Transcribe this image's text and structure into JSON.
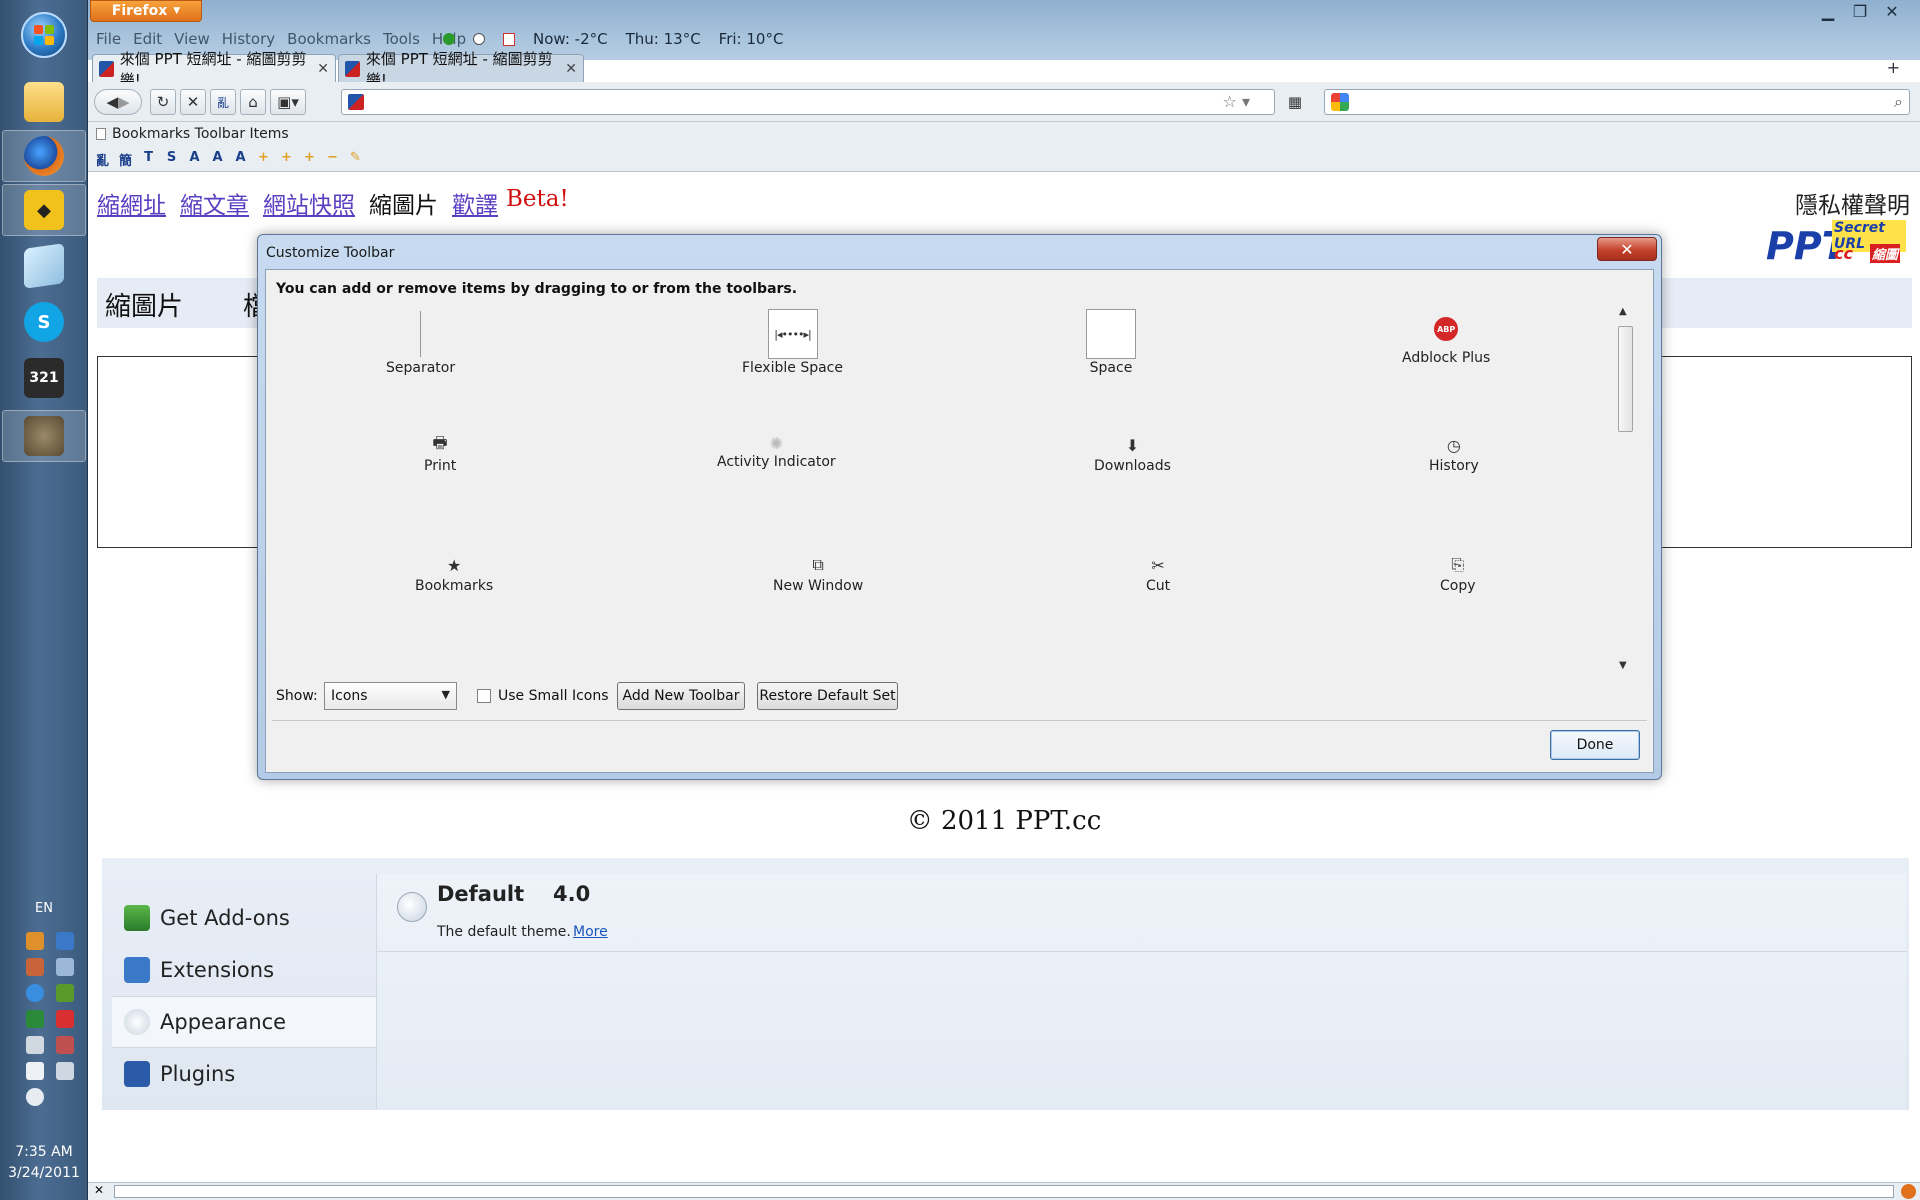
{
  "taskbar": {
    "language": "EN",
    "time": "7:35 AM",
    "date": "3/24/2011",
    "apps": [
      "explorer-icon",
      "firefox-icon",
      "media-icon",
      "notes-icon",
      "skype-icon",
      "media-player-icon",
      "gimp-icon"
    ]
  },
  "firefox": {
    "menu_button": "Firefox",
    "menus": [
      "File",
      "Edit",
      "View",
      "History",
      "Bookmarks",
      "Tools",
      "Help"
    ],
    "weather": {
      "now": "Now: -2°C",
      "thu": "Thu: 13°C",
      "fri": "Fri: 10°C"
    },
    "tabs": [
      {
        "title": "來個 PPT 短網址 - 縮圖剪剪樂!"
      },
      {
        "title": "來個 PPT 短網址 - 縮圖剪剪樂!"
      }
    ],
    "bookmarks_label": "Bookmarks Toolbar Items",
    "bm_icons": [
      "亂",
      "簡",
      "T",
      "S",
      "A",
      "A",
      "A",
      "+",
      "+",
      "+",
      "−",
      "✎"
    ]
  },
  "page": {
    "nav": {
      "short_url": "縮網址",
      "short_article": "縮文章",
      "snapshot": "網站快照",
      "thumbnail": "縮圖片",
      "translate": "歡譯",
      "beta": "Beta!"
    },
    "privacy": "隱私權聲明",
    "logo": {
      "main": "PPT",
      "sub": "Secret URL",
      "cc": "cc",
      "cn": "縮圖"
    },
    "section_title": "縮圖片",
    "section_title2": "檔",
    "footer": "© 2011 PPT.cc"
  },
  "addons": {
    "sidebar": [
      {
        "label": "Get Add-ons"
      },
      {
        "label": "Extensions"
      },
      {
        "label": "Appearance"
      },
      {
        "label": "Plugins"
      }
    ],
    "theme": {
      "name": "Default",
      "version": "4.0",
      "description": "The default theme.",
      "more": "More"
    }
  },
  "dialog": {
    "title": "Customize Toolbar",
    "close": "✕",
    "hint": "You can add or remove items by dragging to or from the toolbars.",
    "items": [
      {
        "label": "Separator"
      },
      {
        "label": "Flexible Space",
        "glyph": "|◂••••▸|"
      },
      {
        "label": "Space"
      },
      {
        "label": "Adblock Plus",
        "glyph": "ABP"
      },
      {
        "label": "Print",
        "glyph": "🖶"
      },
      {
        "label": "Activity Indicator",
        "glyph": "✺"
      },
      {
        "label": "Downloads",
        "glyph": "⬇"
      },
      {
        "label": "History",
        "glyph": "◷"
      },
      {
        "label": "Bookmarks",
        "glyph": "★"
      },
      {
        "label": "New Window",
        "glyph": "⧉"
      },
      {
        "label": "Cut",
        "glyph": "✂"
      },
      {
        "label": "Copy",
        "glyph": "⎘"
      }
    ],
    "show_label": "Show:",
    "show_value": "Icons",
    "small_icons_label": "Use Small Icons",
    "add_toolbar": "Add New Toolbar",
    "restore": "Restore Default Set",
    "done": "Done"
  }
}
